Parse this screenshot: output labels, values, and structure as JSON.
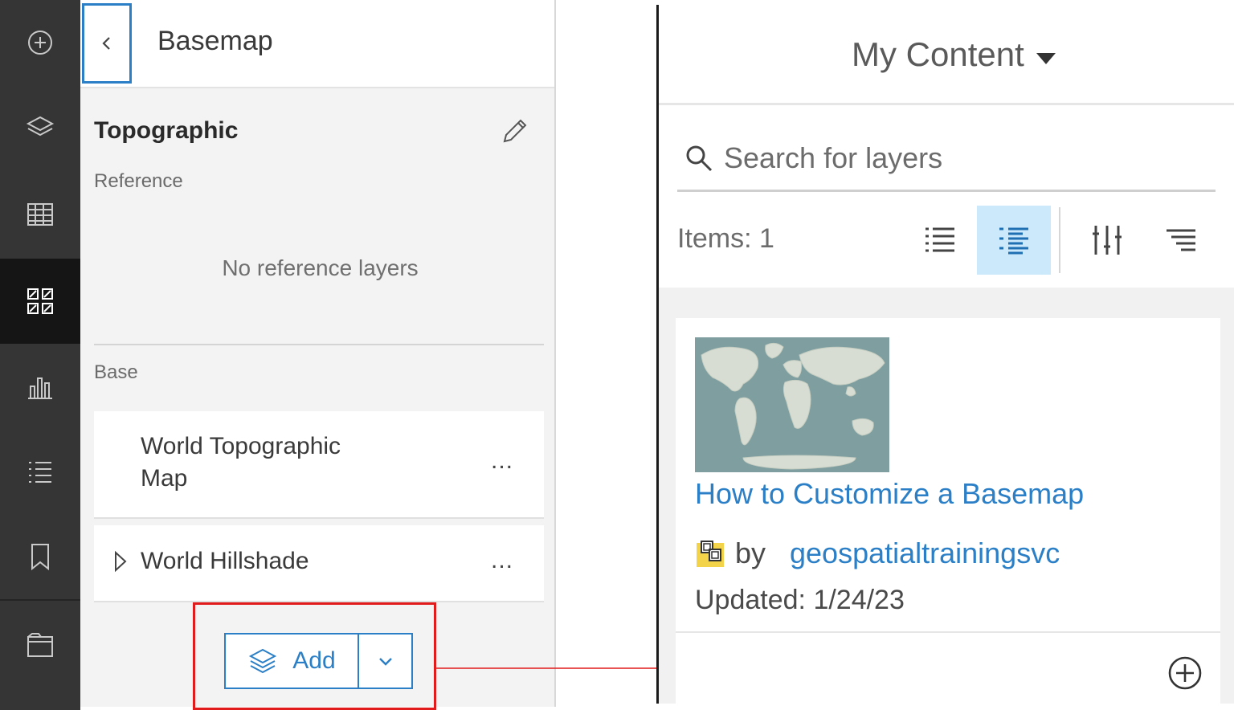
{
  "basemap_panel": {
    "title": "Basemap",
    "basemap_name": "Topographic",
    "reference_label": "Reference",
    "reference_empty": "No reference layers",
    "base_label": "Base",
    "layers": [
      {
        "name": "World Topographic Map",
        "more": "..."
      },
      {
        "name": "World Hillshade",
        "more": "..."
      }
    ],
    "add_button_label": "Add"
  },
  "rail": {
    "items": [
      "add-icon",
      "layers-icon",
      "table-icon",
      "basemap-gallery-icon",
      "chart-icon",
      "legend-icon",
      "bookmark-icon",
      "folder-icon"
    ],
    "active": "basemap-gallery-icon"
  },
  "content_panel": {
    "title": "My Content",
    "search_placeholder": "Search for layers",
    "items_count": "Items: 1",
    "item": {
      "title": "How to Customize a Basemap",
      "by": "by",
      "owner": "geospatialtrainingsvc",
      "updated": "Updated: 1/24/23"
    }
  },
  "colors": {
    "accent": "#2b7fc6",
    "highlight": "#e11b1b",
    "rail_bg": "#353535",
    "selected_view_bg": "#cce8fb"
  }
}
